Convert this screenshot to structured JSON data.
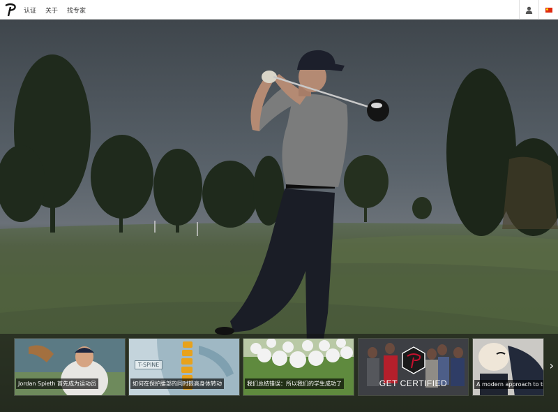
{
  "header": {
    "nav": [
      "认证",
      "关于",
      "找专家"
    ],
    "user_icon": "user-icon",
    "language_icon": "china-flag-icon"
  },
  "hero": {
    "scene": "golfer-follow-through"
  },
  "thumbnails": [
    {
      "caption": "Jordan Spieth 首先成为运动员"
    },
    {
      "caption": "如何在保护腰部的同时提高身体转动",
      "badge": "T-SPINE"
    },
    {
      "caption": "我们总结错误：所以我们的学生成功了"
    },
    {
      "title": "GET CERTIFIED"
    },
    {
      "caption": "A modern approach to trai"
    }
  ],
  "strip_arrow": "›",
  "colors": {
    "flag_red": "#de2910",
    "logo_red": "#c8102e"
  }
}
